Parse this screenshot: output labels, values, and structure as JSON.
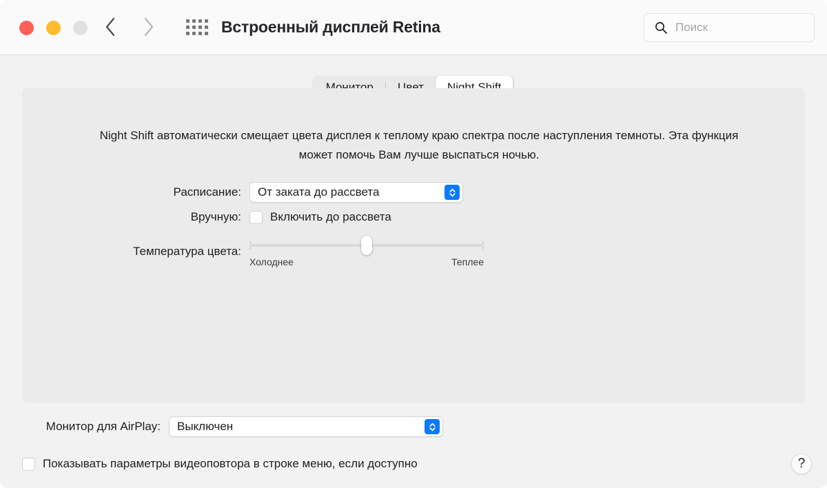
{
  "window": {
    "title": "Встроенный дисплей Retina",
    "traffic_lights": {
      "close": "close-button",
      "minimize": "minimize-button",
      "zoom": "zoom-button",
      "close_color": "#ff5f57",
      "minimize_color": "#febc2e",
      "zoom_color": "#e0e0e0"
    }
  },
  "toolbar": {
    "back": "back-arrow",
    "forward": "forward-arrow",
    "grid": "show-all-grid",
    "search": {
      "placeholder": "Поиск",
      "value": ""
    }
  },
  "tabs": [
    {
      "label": "Монитор",
      "selected": false
    },
    {
      "label": "Цвет",
      "selected": false
    },
    {
      "label": "Night Shift",
      "selected": true
    }
  ],
  "main": {
    "description": "Night Shift автоматически смещает цвета дисплея к теплому краю спектра после наступления темноты. Эта функция может помочь Вам лучше выспаться ночью.",
    "schedule": {
      "label": "Расписание:",
      "value": "От заката до рассвета"
    },
    "manual": {
      "label": "Вручную:",
      "checkbox_label": "Включить до рассвета",
      "checked": false
    },
    "temperature": {
      "label": "Температура цвета:",
      "min_label": "Холоднее",
      "max_label": "Теплее",
      "value_percent": 50
    }
  },
  "bottom": {
    "airplay": {
      "label": "Монитор для AirPlay:",
      "value": "Выключен"
    },
    "mirroring": {
      "checkbox_label": "Показывать параметры видеоповтора в строке меню, если доступно",
      "checked": false
    },
    "help": "?"
  },
  "colors": {
    "accent": "#0a7aff",
    "panel_bg": "#ebebeb",
    "window_bg": "#f2f2f2",
    "titlebar_bg": "#fafafa"
  }
}
